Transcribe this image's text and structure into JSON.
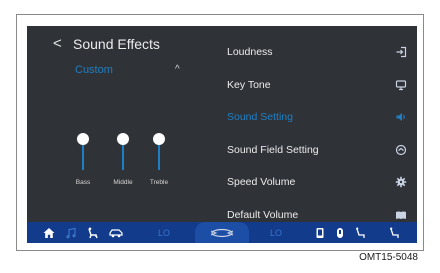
{
  "header": {
    "back_symbol": "<",
    "title": "Sound Effects"
  },
  "preset": {
    "label": "Custom",
    "chevron": "^"
  },
  "equalizer": {
    "bands": [
      {
        "label": "Bass",
        "level": 0.95
      },
      {
        "label": "Middle",
        "level": 0.95
      },
      {
        "label": "Treble",
        "level": 0.95
      }
    ]
  },
  "menu": {
    "items": [
      {
        "label": "Loudness",
        "icon": "enter-icon"
      },
      {
        "label": "Key Tone",
        "icon": "monitor-icon"
      },
      {
        "label": "Sound Setting",
        "icon": "speaker-icon",
        "active": true
      },
      {
        "label": "Sound Field Setting",
        "icon": "target-icon"
      },
      {
        "label": "Speed Volume",
        "icon": "gear-icon"
      },
      {
        "label": "Default Volume",
        "icon": "book-icon"
      }
    ]
  },
  "bottom_bar": {
    "left_temp": "LO",
    "right_temp": "LO"
  },
  "caption": "OMT15-5048",
  "colors": {
    "accent": "#1f7fc4",
    "screen_bg": "#2f3237",
    "bottom_bar": "#123b8c",
    "text": "#ececec"
  }
}
